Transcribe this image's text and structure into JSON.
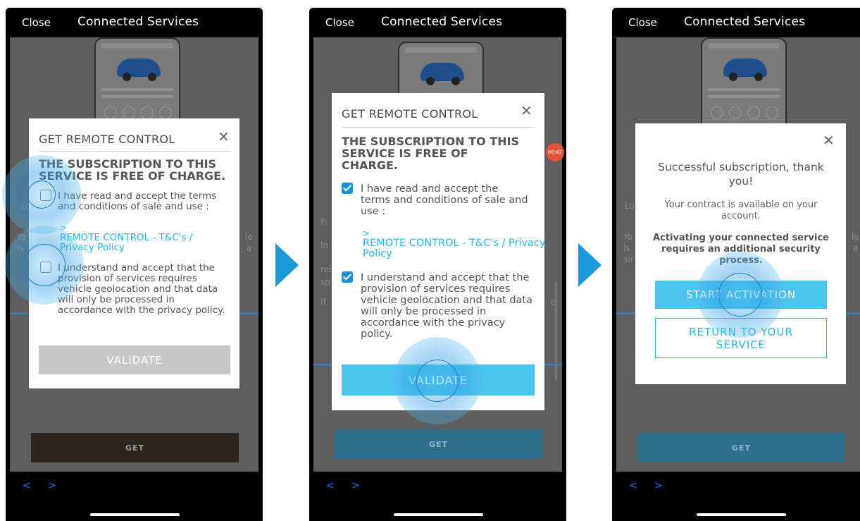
{
  "top": {
    "close": "Close",
    "title": "Connected Services"
  },
  "nav": {
    "arrows": "< >"
  },
  "background": {
    "get_label": "GET",
    "bg_lo": "Lo",
    "bg_yo": "Yo",
    "bg_is": "is",
    "bg_sir": "sir",
    "bg_le": "le",
    "bg_a": "a",
    "bg_fi": "Fi",
    "bg_in": "In",
    "bg_res": "res",
    "bg_sp": "sp",
    "bg_if": "If",
    "bg_e": "e",
    "bg_timer": "00:42"
  },
  "modal1": {
    "title": "GET REMOTE CONTROL",
    "heading": "THE SUBSCRIPTION TO THIS SERVICE IS FREE OF CHARGE.",
    "cb1_text": "I have read and accept the terms and conditions of sale and use :",
    "link_arrow": ">",
    "link_text": "REMOTE CONTROL - T&C's / Privacy Policy",
    "cb2_text": "I understand and accept that the provision of services requires vehicle geolocation and that data will only be processed in accordance with the privacy policy.",
    "validate": "VALIDATE",
    "checked": [
      false,
      false
    ]
  },
  "modal2": {
    "title": "GET REMOTE CONTROL",
    "heading": "THE SUBSCRIPTION TO THIS SERVICE IS FREE OF CHARGE.",
    "cb1_text": "I have read and accept the terms and conditions of sale and use :",
    "link_arrow": ">",
    "link_text": "REMOTE CONTROL - T&C's / Privacy Policy",
    "cb2_text": "I understand and accept that the provision of services requires vehicle geolocation and that data will only be processed in accordance with the privacy policy.",
    "validate": "VALIDATE",
    "checked": [
      true,
      true
    ]
  },
  "modal3": {
    "success": "Successful subscription, thank you!",
    "contract": "Your contract is available on your account.",
    "security": "Activating your connected service requires an additional security process.",
    "start": "START ACTIVATION",
    "return": "RETURN TO YOUR SERVICE"
  },
  "colors": {
    "accent": "#29b7e8",
    "validate_disabled": "#c8c8c8",
    "validate_enabled": "#4bc3ef",
    "arrow": "#1a9ad9",
    "checkbox": "#1a8fd6"
  }
}
